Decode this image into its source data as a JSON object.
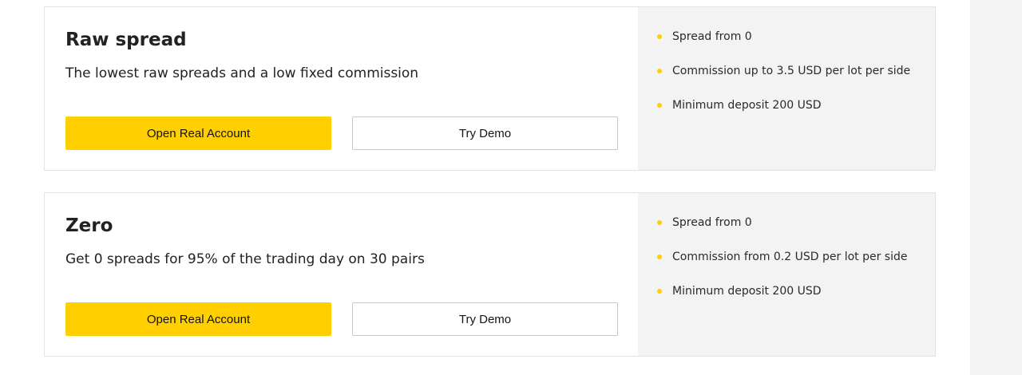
{
  "accounts": [
    {
      "title": "Raw spread",
      "description": "The lowest raw spreads and a low fixed commission",
      "primary_button": "Open Real Account",
      "secondary_button": "Try Demo",
      "features": [
        "Spread from 0",
        "Commission up to 3.5 USD per lot per side",
        "Minimum deposit 200 USD"
      ]
    },
    {
      "title": "Zero",
      "description": "Get 0 spreads for 95% of the trading day on 30 pairs",
      "primary_button": "Open Real Account",
      "secondary_button": "Try Demo",
      "features": [
        "Spread from 0",
        "Commission from 0.2 USD per lot per side",
        "Minimum deposit 200 USD"
      ]
    }
  ],
  "colors": {
    "accent": "#ffcf00",
    "side_panel": "#f3f3f3",
    "page_gutter": "#f3f3f4"
  },
  "icons": {
    "feature_bullet": "bullet-dot-icon"
  }
}
